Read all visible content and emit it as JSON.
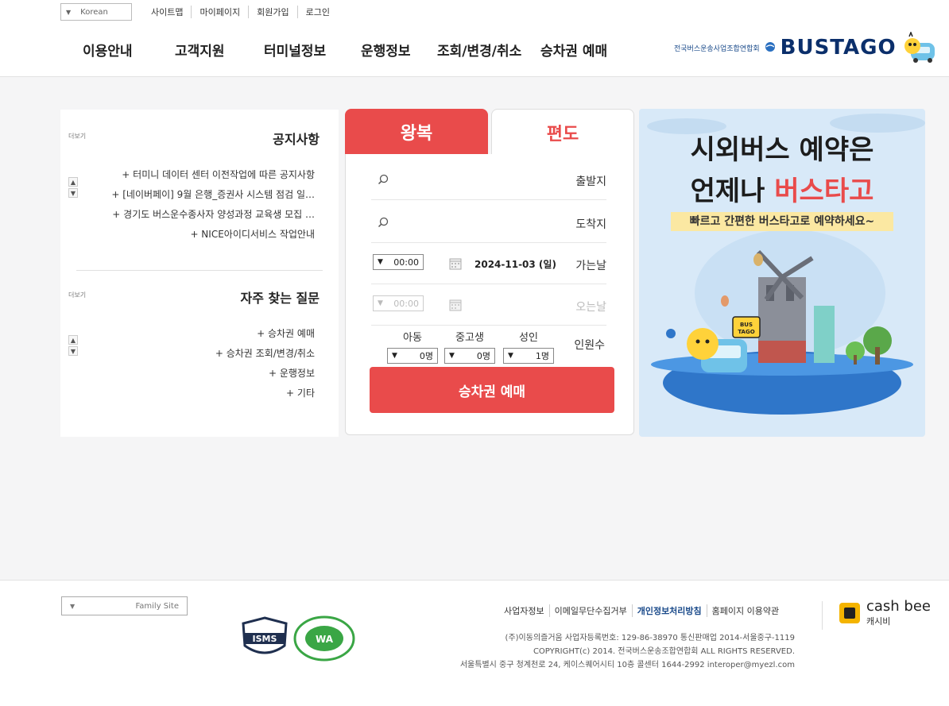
{
  "header": {
    "language_select": "Korean",
    "util_links": [
      "로그인",
      "회원가입",
      "마이페이지",
      "사이트맵"
    ],
    "nav": [
      "승차권 예매",
      "조회/변경/취소",
      "운행정보",
      "터미널정보",
      "고객지원",
      "이용안내"
    ],
    "logo_brand": "BUSTAGO",
    "logo_sub": "전국버스운송사업조합연합회"
  },
  "notices": {
    "title": "공지사항",
    "more": "더보기",
    "items": [
      "+ 터미니 데이터 센터 이전작업에 따른 공지사항",
      "+ [네이버페이] 9월 은행_증권사 시스템 점검 일…",
      "+ 경기도 버스운수종사자 양성과정 교육생 모집 …",
      "+ NICE아이디서비스 작업안내"
    ]
  },
  "faq": {
    "title": "자주 찾는 질문",
    "more": "더보기",
    "items": [
      "+ 승차권 예매",
      "+ 승차권 조회/변경/취소",
      "+ 운행정보",
      "+ 기타"
    ]
  },
  "booking": {
    "tab_roundtrip": "왕복",
    "tab_oneway": "편도",
    "departure_label": "출발지",
    "arrival_label": "도착지",
    "depart_date_label": "가는날",
    "depart_date": "2024-11-03 (일)",
    "depart_time": "00:00",
    "return_date_label": "오는날",
    "return_time": "00:00",
    "passenger_label": "인원수",
    "adult_label": "성인",
    "adult_value": "1명",
    "student_label": "중고생",
    "student_value": "0명",
    "child_label": "아동",
    "child_value": "0명",
    "reserve_button": "승차권 예매"
  },
  "banner": {
    "line1": "시외버스 예약은",
    "line2_prefix": "언제나 ",
    "line2_highlight": "버스타고",
    "line3": "빠르고 간편한 버스타고로 예약하세요~",
    "bus_sign": "BUS TAGO"
  },
  "footer": {
    "family_site": "Family Site",
    "links": [
      "홈페이지 이용약관",
      "개인정보처리방침",
      "이메일무단수집거부",
      "사업자정보"
    ],
    "info": [
      "(주)이동의즐거움   사업자등록번호: 129-86-38970   통신판매업 2014-서울중구-1119",
      "COPYRIGHT(c) 2014. 전국버스운송조합연합회      ALL RIGHTS RESERVED.",
      "서울특별시 중구 청계천로 24, 케이스퀘어시티 10층    콜센터 1644-2992    interoper@myezl.com"
    ],
    "cashbee_name": "cash bee",
    "cashbee_sub": "캐시비",
    "cert1": "WA",
    "cert2": "ISMS"
  }
}
